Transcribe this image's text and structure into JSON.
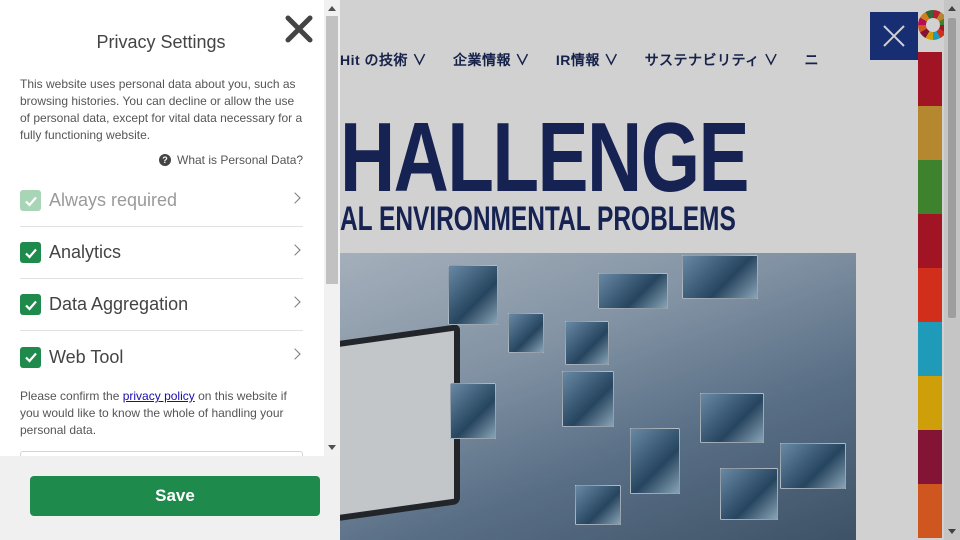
{
  "background_site": {
    "nav_items": [
      "Hit の技術 ∨",
      "企業情報 ∨",
      "IR情報 ∨",
      "サステナビリティ ∨",
      "ニ"
    ],
    "hero_title": "HALLENGE",
    "hero_subtitle": "AL ENVIRONMENTAL PROBLEMS",
    "accent_color": "#1d3a8c",
    "sdg_colors": [
      "#e5243b",
      "#c5192d",
      "#dda63a",
      "#4c9f38",
      "#c5192d",
      "#ff3a21",
      "#26bde2",
      "#fcc30b",
      "#a21942",
      "#fd6925"
    ]
  },
  "privacy_panel": {
    "title": "Privacy Settings",
    "intro": "This website uses personal data about you, such as browsing histories. You can decline or allow the use of personal data, except for vital data necessary for a fully functioning website.",
    "personal_data_link": "What is Personal Data?",
    "categories": [
      {
        "label": "Always required",
        "checked": true,
        "disabled": true
      },
      {
        "label": "Analytics",
        "checked": true,
        "disabled": false
      },
      {
        "label": "Data Aggregation",
        "checked": true,
        "disabled": false
      },
      {
        "label": "Web Tool",
        "checked": true,
        "disabled": false
      }
    ],
    "policy_before": "Please confirm the ",
    "policy_link": "privacy policy",
    "policy_after": " on this website if you would like to know the whole of handling your personal data.",
    "save_label": "Save",
    "accent_color": "#1e8a4c"
  }
}
